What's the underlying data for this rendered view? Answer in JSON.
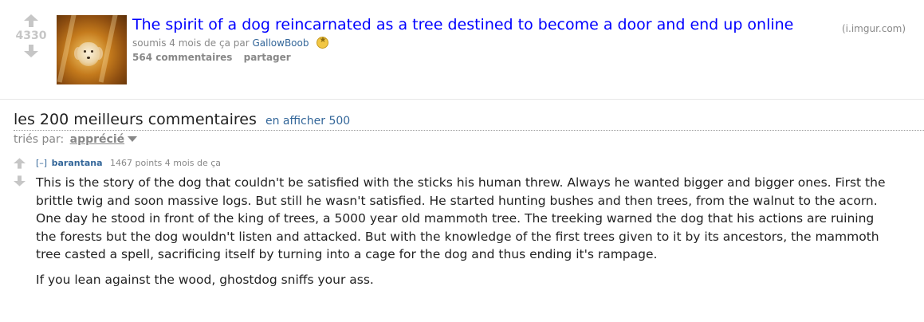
{
  "post": {
    "score": "4330",
    "title": "The spirit of a dog reincarnated as a tree destined to become a door and end up online",
    "domain": "(i.imgur.com)",
    "tagline": {
      "prefix": "soumis 4 mois de ça par ",
      "author": "GallowBoob"
    },
    "buttons": {
      "comments": "564 commentaires",
      "share": "partager"
    }
  },
  "comment_area": {
    "title": "les 200 meilleurs commentaires",
    "show_more": "en afficher 500",
    "sort_prefix": "triés par:",
    "sort_selected": "apprécié"
  },
  "comment": {
    "toggle": "[–]",
    "author": "barantana",
    "points": "1467 points 4 mois de ça",
    "paragraphs": [
      "This is the story of the dog that couldn't be satisfied with the sticks his human threw. Always he wanted bigger and bigger ones. First the brittle twig and soon massive logs. But still he wasn't satisfied. He started hunting bushes and then trees, from the walnut to the acorn. One day he stood in front of the king of trees, a 5000 year old mammoth tree. The treeking warned the dog that his actions are ruining the forests but the dog wouldn't listen and attacked. But with the knowledge of the first trees given to it by its ancestors, the mammoth tree casted a spell, sacrificing itself by turning into a cage for the dog and thus ending it's rampage.",
      "If you lean against the wood, ghostdog sniffs your ass."
    ]
  },
  "colors": {
    "title_link": "#0000ff",
    "user_link": "#336699",
    "muted": "#888888",
    "score": "#c6c6c6"
  }
}
